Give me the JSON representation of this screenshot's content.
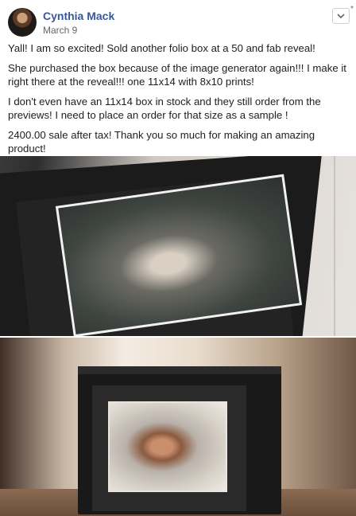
{
  "post": {
    "author": "Cynthia Mack",
    "date": "March 9",
    "menu_icon": "chevron-down-icon",
    "paragraphs": [
      "Yall! I am so excited! Sold another folio box at a 50 and fab reveal!",
      "She purchased the box because of the image generator again!!! I make it right there at the reveal!!! one 11x14 with 8x10 prints!",
      "I don't even have an 11x14 box in stock and they still order from the previews! I need to place an order for that size as a sample !",
      "2400.00 sale after tax! Thank you so much for making an amazing product!"
    ]
  },
  "colors": {
    "author_link": "#365899",
    "meta_text": "#616770",
    "body_text": "#1c1e21"
  }
}
